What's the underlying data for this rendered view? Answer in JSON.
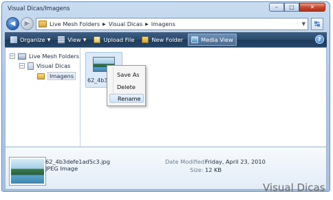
{
  "window": {
    "title": "Visual Dicas/Imagens"
  },
  "title_buttons": {
    "minimize": "–",
    "maximize": "□",
    "close": "✕"
  },
  "address": {
    "crumbs": [
      "Live Mesh Folders",
      "Visual Dicas",
      "Imagens"
    ],
    "separator": "▶",
    "dropdown": "▼",
    "refresh": "↹"
  },
  "nav": {
    "back": "◀",
    "forward": "▶"
  },
  "toolbar": {
    "organize": "Organize",
    "view": "View",
    "upload": "Upload File",
    "new_folder": "New Folder",
    "media_view": "Media View",
    "caret": "▼",
    "help": "?"
  },
  "tree": {
    "collapse": "−",
    "items": [
      "Live Mesh Folders",
      "Visual Dicas",
      "Imagens"
    ]
  },
  "file": {
    "tile_label": "62_4b3def"
  },
  "context_menu": {
    "items": [
      "Save As",
      "Delete",
      "Rename"
    ]
  },
  "details": {
    "filename": "62_4b3defe1ad5c3.jpg",
    "type": "JPEG Image",
    "modified_label": "Date Modified:",
    "modified_value": "Friday, April 23, 2010",
    "size_label": "Size:",
    "size_value": "12 KB"
  },
  "watermark": "Visual Dicas"
}
